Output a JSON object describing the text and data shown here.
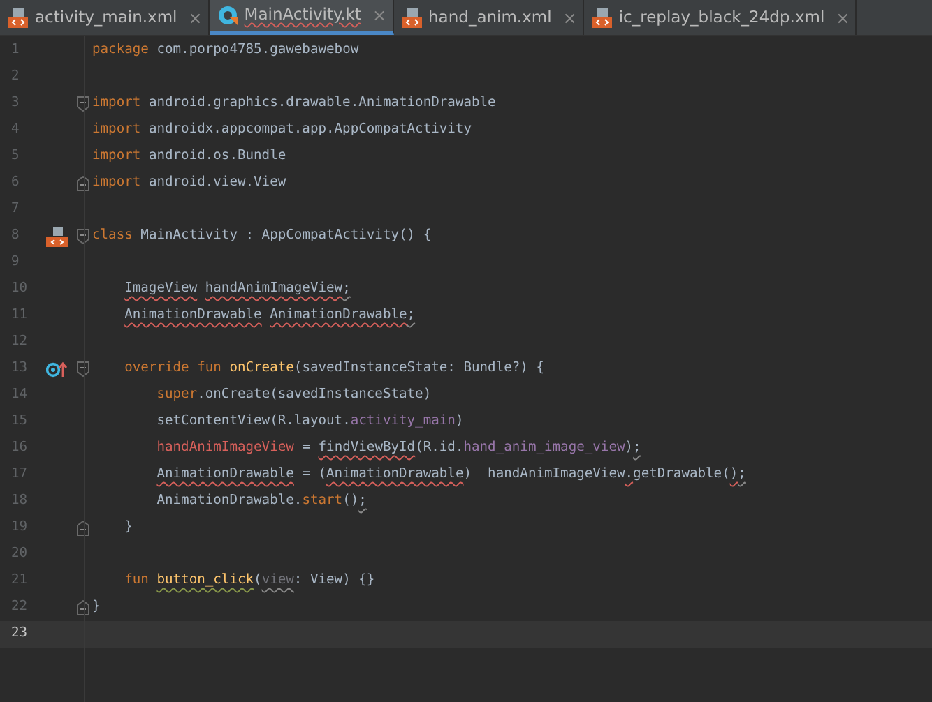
{
  "tabs": [
    {
      "label": "activity_main.xml",
      "kind": "xml",
      "close": "×",
      "selected": false
    },
    {
      "label": "MainActivity.kt",
      "kind": "kotlin",
      "close": "×",
      "selected": true
    },
    {
      "label": "hand_anim.xml",
      "kind": "xml",
      "close": "×",
      "selected": false
    },
    {
      "label": "ic_replay_black_24dp.xml",
      "kind": "xml",
      "close": "×",
      "selected": false
    }
  ],
  "editor": {
    "lines": [
      {
        "number": "1",
        "current": false,
        "tokens": [
          {
            "text": "package",
            "kind": "keyword"
          },
          {
            "text": " com.porpo4785.gawebawebow",
            "kind": "plain"
          }
        ]
      },
      {
        "number": "2",
        "current": false
      },
      {
        "number": "3",
        "current": false,
        "fold": {
          "kind": "start"
        },
        "tokens": [
          {
            "text": "import",
            "kind": "keyword"
          },
          {
            "text": " android.graphics.drawable.AnimationDrawable",
            "kind": "plain"
          }
        ]
      },
      {
        "number": "4",
        "current": false,
        "tokens": [
          {
            "text": "import",
            "kind": "keyword"
          },
          {
            "text": " androidx.appcompat.app.AppCompatActivity",
            "kind": "plain"
          }
        ]
      },
      {
        "number": "5",
        "current": false,
        "tokens": [
          {
            "text": "import",
            "kind": "keyword"
          },
          {
            "text": " android.os.Bundle",
            "kind": "plain"
          }
        ]
      },
      {
        "number": "6",
        "current": false,
        "fold": {
          "kind": "end"
        },
        "tokens": [
          {
            "text": "import",
            "kind": "keyword"
          },
          {
            "text": " android.view.View",
            "kind": "plain"
          }
        ]
      },
      {
        "number": "7",
        "current": false
      },
      {
        "number": "8",
        "current": false,
        "fold": {
          "kind": "start"
        },
        "gutter": {
          "kind": "class"
        },
        "tokens": [
          {
            "text": "class",
            "kind": "keyword"
          },
          {
            "text": " MainActivity : AppCompatActivity() {",
            "kind": "plain"
          }
        ]
      },
      {
        "number": "9",
        "current": false
      },
      {
        "number": "10",
        "current": false,
        "tokens": [
          {
            "text": "    ImageView",
            "kind": "plain",
            "squiggle": {
              "kind": "error"
            }
          },
          {
            "text": " handAnimImageView",
            "kind": "plain",
            "squiggle": {
              "kind": "error"
            }
          },
          {
            "text": ";",
            "kind": "plain",
            "squiggle": {
              "kind": "weak"
            }
          }
        ]
      },
      {
        "number": "11",
        "current": false,
        "tokens": [
          {
            "text": "    AnimationDrawable",
            "kind": "plain",
            "squiggle": {
              "kind": "error"
            }
          },
          {
            "text": " AnimationDrawable",
            "kind": "plain",
            "squiggle": {
              "kind": "error"
            }
          },
          {
            "text": ";",
            "kind": "plain",
            "squiggle": {
              "kind": "weak"
            }
          }
        ]
      },
      {
        "number": "12",
        "current": false
      },
      {
        "number": "13",
        "current": false,
        "fold": {
          "kind": "start"
        },
        "gutter": {
          "kind": "override"
        },
        "tokens": [
          {
            "text": "    override fun",
            "kind": "keyword"
          },
          {
            "text": " onCreate",
            "kind": "function"
          },
          {
            "text": "(savedInstanceState: Bundle?) {",
            "kind": "plain"
          }
        ]
      },
      {
        "number": "14",
        "current": false,
        "tokens": [
          {
            "text": "        super",
            "kind": "keyword"
          },
          {
            "text": ".onCreate(savedInstanceState)",
            "kind": "plain"
          }
        ]
      },
      {
        "number": "15",
        "current": false,
        "tokens": [
          {
            "text": "        setContentView(R.layout.",
            "kind": "plain"
          },
          {
            "text": "activity_main",
            "kind": "property"
          },
          {
            "text": ")",
            "kind": "plain"
          }
        ]
      },
      {
        "number": "16",
        "current": false,
        "tokens": [
          {
            "text": "        handAnimImageView",
            "kind": "unresolved"
          },
          {
            "text": " = ",
            "kind": "plain"
          },
          {
            "text": "findViewById",
            "kind": "plain",
            "squiggle": {
              "kind": "error"
            }
          },
          {
            "text": "(R.id.",
            "kind": "plain"
          },
          {
            "text": "hand_anim_image_view",
            "kind": "property"
          },
          {
            "text": ")",
            "kind": "plain"
          },
          {
            "text": ";",
            "kind": "plain",
            "squiggle": {
              "kind": "weak"
            }
          }
        ]
      },
      {
        "number": "17",
        "current": false,
        "tokens": [
          {
            "text": "        AnimationDrawable",
            "kind": "plain",
            "squiggle": {
              "kind": "error"
            }
          },
          {
            "text": " = (",
            "kind": "plain"
          },
          {
            "text": "AnimationDrawable",
            "kind": "plain",
            "squiggle": {
              "kind": "error"
            }
          },
          {
            "text": ")  handAnimImageView",
            "kind": "plain"
          },
          {
            "text": ".",
            "kind": "plain",
            "squiggle": {
              "kind": "error"
            }
          },
          {
            "text": "getDrawable(",
            "kind": "plain"
          },
          {
            "text": ")",
            "kind": "plain",
            "squiggle": {
              "kind": "error"
            }
          },
          {
            "text": ";",
            "kind": "plain",
            "squiggle": {
              "kind": "weak"
            }
          }
        ]
      },
      {
        "number": "18",
        "current": false,
        "tokens": [
          {
            "text": "        AnimationDrawable.",
            "kind": "plain"
          },
          {
            "text": "start",
            "kind": "keyword"
          },
          {
            "text": "()",
            "kind": "plain"
          },
          {
            "text": ";",
            "kind": "plain",
            "squiggle": {
              "kind": "weak"
            }
          }
        ]
      },
      {
        "number": "19",
        "current": false,
        "fold": {
          "kind": "end"
        },
        "tokens": [
          {
            "text": "    }",
            "kind": "plain"
          }
        ]
      },
      {
        "number": "20",
        "current": false
      },
      {
        "number": "21",
        "current": false,
        "tokens": [
          {
            "text": "    fun",
            "kind": "keyword"
          },
          {
            "text": " button_click",
            "kind": "function",
            "squiggle": {
              "kind": "typo"
            }
          },
          {
            "text": "(",
            "kind": "plain"
          },
          {
            "text": "view",
            "kind": "unused",
            "squiggle": {
              "kind": "weak"
            }
          },
          {
            "text": ": View) {}",
            "kind": "plain"
          }
        ]
      },
      {
        "number": "22",
        "current": false,
        "fold": {
          "kind": "end"
        },
        "tokens": [
          {
            "text": "}",
            "kind": "plain"
          }
        ]
      },
      {
        "number": "23",
        "current": true
      }
    ]
  }
}
